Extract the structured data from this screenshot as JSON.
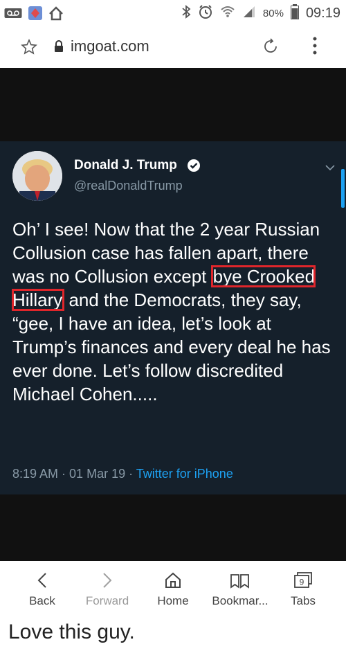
{
  "statusbar": {
    "battery": "80%",
    "time": "09:19",
    "icons": [
      "voicemail-icon",
      "shield-app-icon",
      "home-app-icon",
      "bluetooth-icon",
      "alarm-icon",
      "wifi-icon",
      "signal-icon",
      "battery-icon"
    ]
  },
  "browser": {
    "url": "imgoat.com",
    "icons": [
      "star-icon",
      "lock-icon",
      "reload-icon",
      "more-vert-icon"
    ]
  },
  "tweet": {
    "name": "Donald J. Trump",
    "handle": "@realDonaldTrump",
    "text_before": "Oh’ I see! Now that the 2 year Russian Collusion case has fallen apart, there was no Collusion except ",
    "text_highlight": "bye Crooked Hillary",
    "text_after": " and the Democrats, they say, “gee, I have an idea, let’s look at Trump’s finances and every deal he has ever done. Let’s follow discredited Michael Cohen.....",
    "time": "8:19 AM",
    "sep1": " · ",
    "date": "01 Mar 19",
    "sep2": " · ",
    "source": "Twitter for iPhone",
    "colors": {
      "background": "#15202b",
      "text": "#ffffff",
      "muted": "#8899a6",
      "link": "#1da1f2",
      "highlight_box": "#e0262b"
    }
  },
  "bottom_nav": {
    "back": "Back",
    "forward": "Forward",
    "home": "Home",
    "bookmarks": "Bookmar...",
    "tabs": "Tabs",
    "tab_count": "9"
  },
  "caption": "Love this guy."
}
